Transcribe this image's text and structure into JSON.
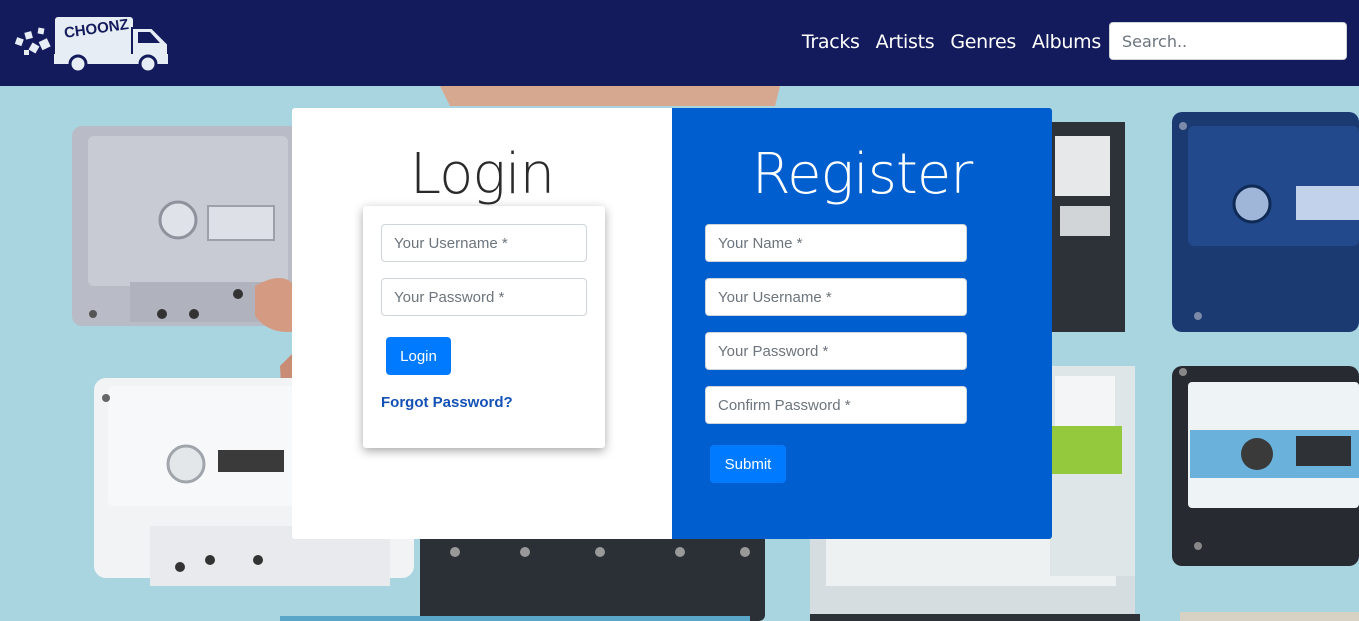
{
  "brand": {
    "logo_text": "CHOONZ"
  },
  "nav": {
    "links": [
      {
        "label": "Tracks"
      },
      {
        "label": "Artists"
      },
      {
        "label": "Genres"
      },
      {
        "label": "Albums"
      }
    ],
    "search_placeholder": "Search.."
  },
  "login": {
    "title": "Login",
    "username_placeholder": "Your Username *",
    "password_placeholder": "Your Password *",
    "button_label": "Login",
    "forgot_label": "Forgot Password?"
  },
  "register": {
    "title": "Register",
    "name_placeholder": "Your Name *",
    "username_placeholder": "Your Username *",
    "password_placeholder": "Your Password *",
    "confirm_placeholder": "Confirm Password *",
    "submit_label": "Submit"
  },
  "colors": {
    "navbar": "#141b5c",
    "register_panel": "#005ecf",
    "button": "#007bff",
    "link": "#1451b5",
    "background": "#a9d5e1"
  }
}
